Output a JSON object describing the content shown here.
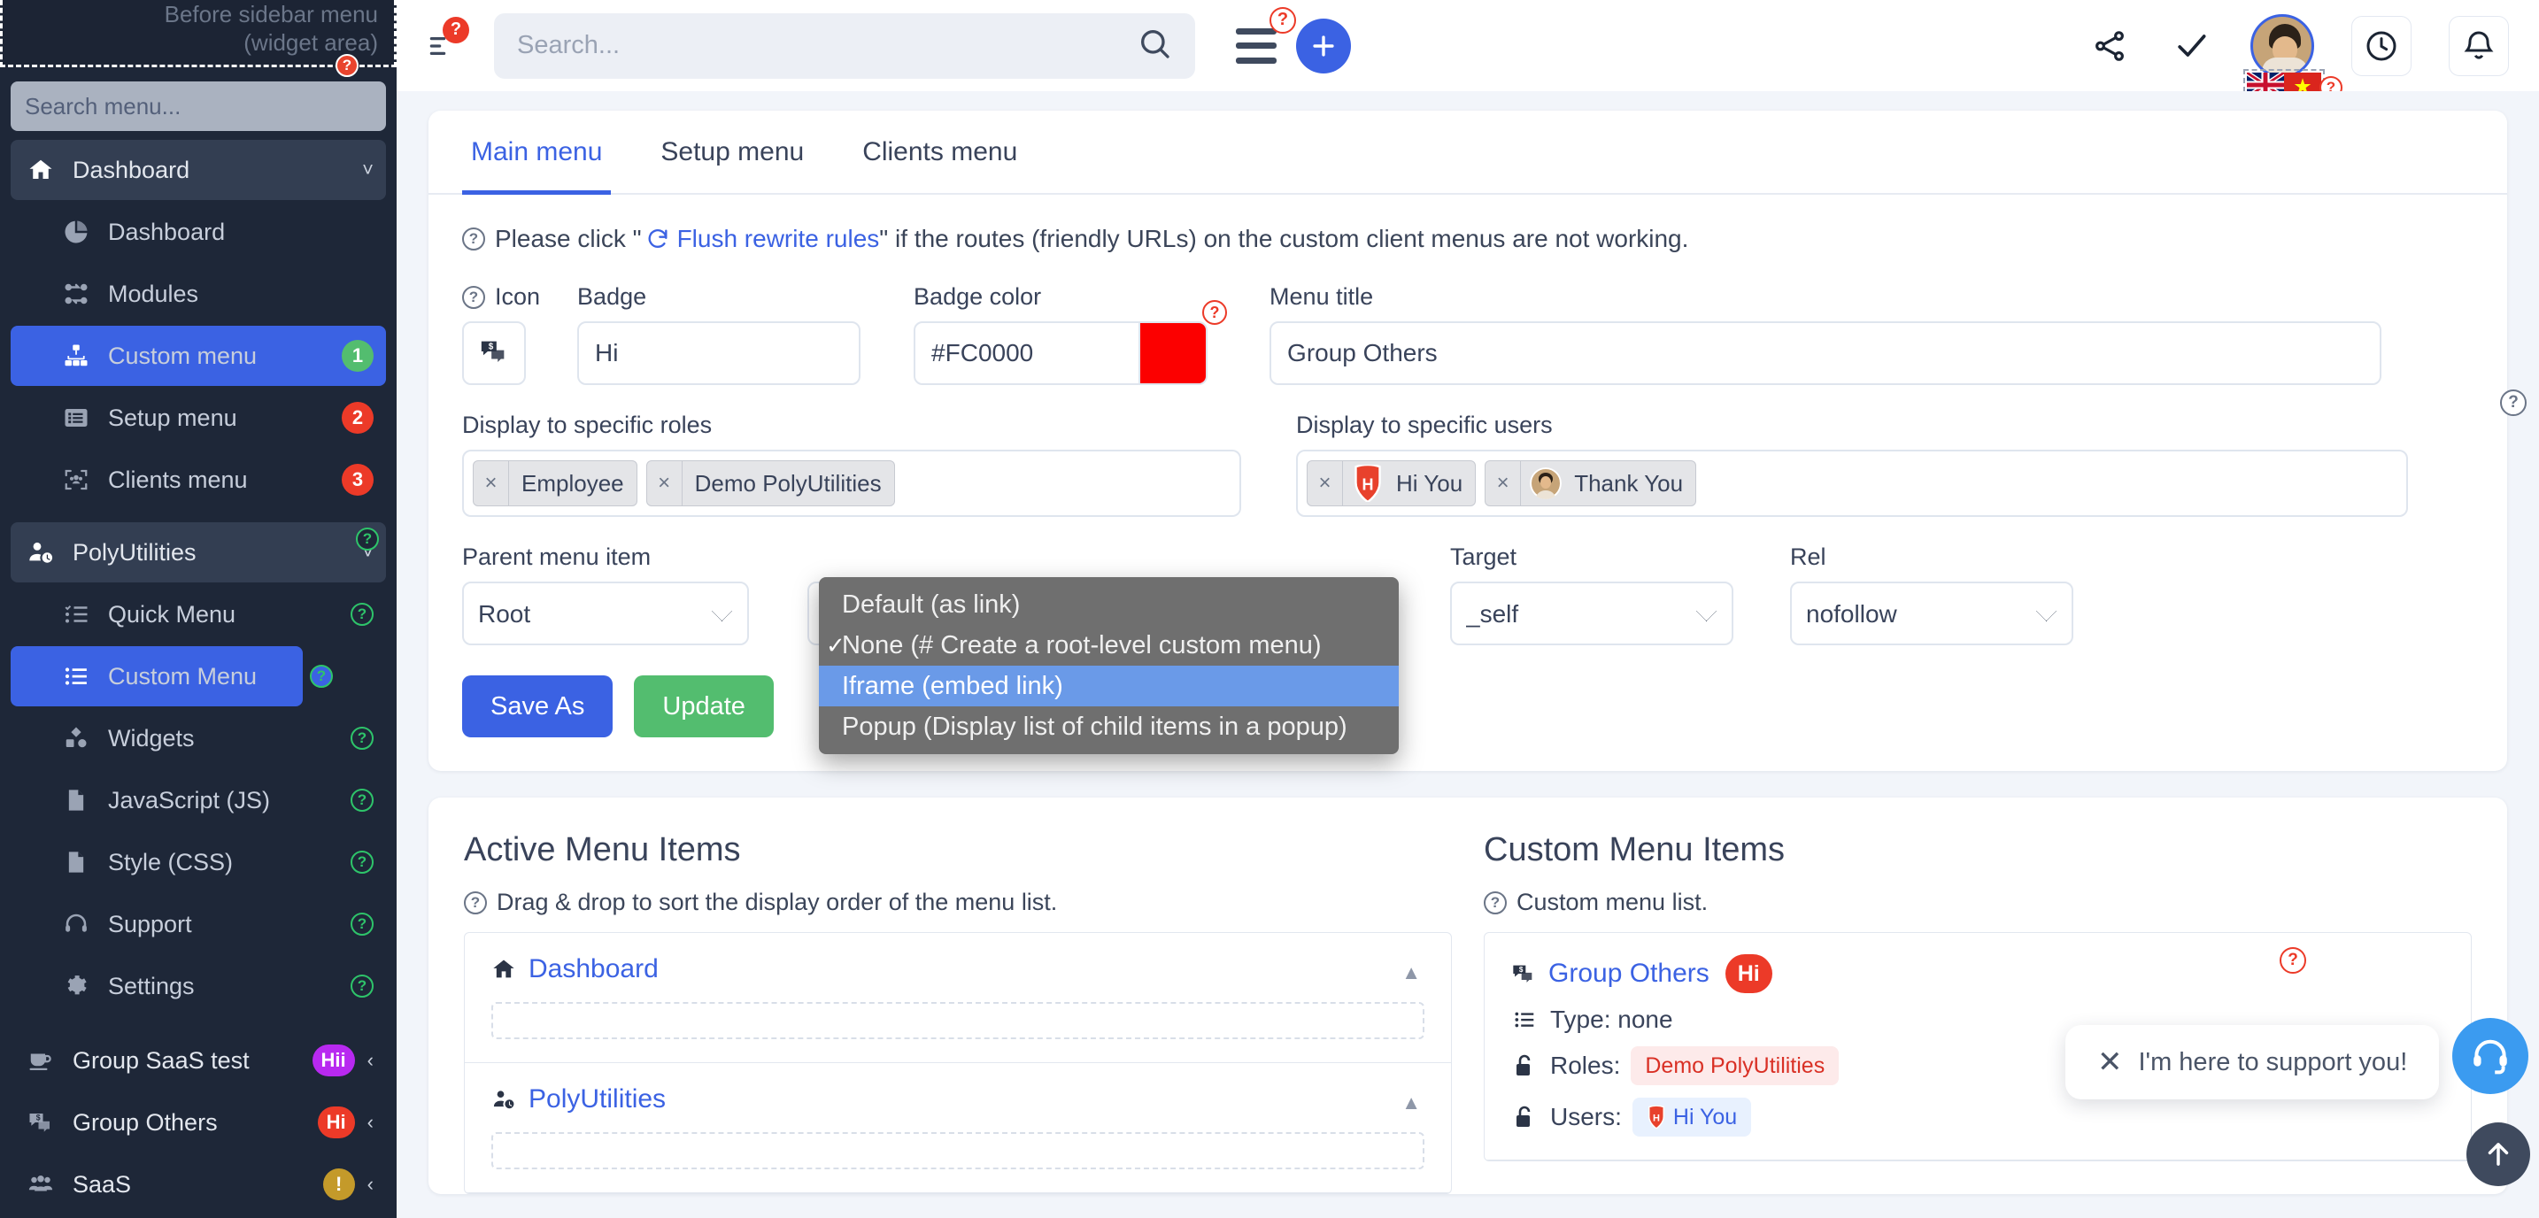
{
  "sidebar": {
    "widget_area_note": "Before sidebar menu (widget area)",
    "search_placeholder": "Search menu...",
    "items": [
      {
        "label": "Dashboard",
        "icon": "home-icon",
        "level": "top",
        "state": "expanded",
        "chevron": "˅"
      },
      {
        "label": "Dashboard",
        "icon": "pie-chart-icon",
        "level": "sub"
      },
      {
        "label": "Modules",
        "icon": "modules-icon",
        "level": "sub"
      },
      {
        "label": "Custom menu",
        "icon": "sitemap-icon",
        "level": "sub",
        "active": true,
        "badge": "1",
        "badge_color": "#53bd6f"
      },
      {
        "label": "Setup menu",
        "icon": "list-box-icon",
        "level": "sub",
        "badge": "2",
        "badge_color": "#ec3a28"
      },
      {
        "label": "Clients menu",
        "icon": "users-frame-icon",
        "level": "sub",
        "badge": "3",
        "badge_color": "#ec3a28"
      },
      {
        "label": "PolyUtilities",
        "icon": "user-clock-icon",
        "level": "top",
        "state": "expanded",
        "chevron": "˅",
        "help": "?"
      },
      {
        "label": "Quick Menu",
        "icon": "checklist-icon",
        "level": "sub",
        "help": "?"
      },
      {
        "label": "Custom Menu",
        "icon": "list-icon",
        "level": "sub",
        "active": true,
        "help": "?"
      },
      {
        "label": "Widgets",
        "icon": "widgets-icon",
        "level": "sub",
        "help": "?"
      },
      {
        "label": "JavaScript (JS)",
        "icon": "file-js-icon",
        "level": "sub",
        "help": "?"
      },
      {
        "label": "Style (CSS)",
        "icon": "file-css-icon",
        "level": "sub",
        "help": "?"
      },
      {
        "label": "Support",
        "icon": "headset-icon",
        "level": "sub",
        "help": "?"
      },
      {
        "label": "Settings",
        "icon": "gear-icon",
        "level": "sub",
        "help": "?"
      },
      {
        "label": "Group SaaS test",
        "icon": "coffee-cup-icon",
        "level": "top",
        "badge": "Hii",
        "badge_color": "#b829f0",
        "chevron": "‹"
      },
      {
        "label": "Group Others",
        "icon": "chat-dollar-icon",
        "level": "top",
        "badge": "Hi",
        "badge_color": "#ec3a28",
        "chevron": "‹"
      },
      {
        "label": "SaaS",
        "icon": "group-users-icon",
        "level": "top",
        "badge": "!",
        "badge_color": "#c49a2a",
        "chevron": "‹"
      }
    ]
  },
  "topbar": {
    "menu_icon": "text-align-icon",
    "menu_badge": "?",
    "search_placeholder": "Search...",
    "search_value": "",
    "search_icon": "search-icon",
    "hamburger_icon": "hamburger-icon",
    "hamburger_badge": "?",
    "add_icon": "plus-icon",
    "share_icon": "share-icon",
    "check_icon": "check-icon",
    "avatar": "user-avatar",
    "flags": [
      "uk-flag",
      "vietnam-flag"
    ],
    "flag_badge": "?",
    "clock_icon": "clock-icon",
    "bell_icon": "bell-icon"
  },
  "main": {
    "tabs": [
      {
        "label": "Main menu",
        "active": true
      },
      {
        "label": "Setup menu",
        "active": false
      },
      {
        "label": "Clients menu",
        "active": false
      }
    ],
    "hint_prefix": "Please click \"",
    "hint_link": "Flush rewrite rules",
    "hint_suffix": "\" if the routes (friendly URLs) on the custom client menus are not working.",
    "fields": {
      "icon_label": "Icon",
      "icon_value": "chat-dollar-icon",
      "badge_label": "Badge",
      "badge_value": "Hi",
      "badge_color_label": "Badge color",
      "badge_color_value": "#FC0000",
      "badge_color_swatch": "#FC0000",
      "badge_color_help": "?",
      "menu_title_label": "Menu title",
      "menu_title_value": "Group Others",
      "roles_label": "Display to specific roles",
      "roles": [
        "Employee",
        "Demo PolyUtilities"
      ],
      "users_label": "Display to specific users",
      "users": [
        "Hi You",
        "Thank You"
      ],
      "parent_label": "Parent menu item",
      "parent_value": "Root",
      "target_label": "Target",
      "target_value": "_self",
      "rel_label": "Rel",
      "rel_value": "nofollow",
      "side_help": "?"
    },
    "dropdown": {
      "options": [
        {
          "label": "Default (as link)",
          "checked": false,
          "highlighted": false
        },
        {
          "label": "None (# Create a root-level custom menu)",
          "checked": true,
          "highlighted": false
        },
        {
          "label": "Iframe (embed link)",
          "checked": false,
          "highlighted": true
        },
        {
          "label": "Popup (Display list of child items in a popup)",
          "checked": false,
          "highlighted": false
        }
      ]
    },
    "buttons": {
      "save_as": "Save As",
      "update": "Update"
    },
    "active_menu": {
      "title": "Active Menu Items",
      "subtitle": "Drag & drop to sort the display order of the menu list.",
      "items": [
        {
          "label": "Dashboard",
          "icon": "home-icon"
        },
        {
          "label": "PolyUtilities",
          "icon": "user-clock-icon"
        }
      ]
    },
    "custom_menu": {
      "title": "Custom Menu Items",
      "subtitle": "Custom menu list.",
      "help": "?",
      "items": [
        {
          "label": "Group Others",
          "icon": "chat-dollar-icon",
          "badge": "Hi",
          "badge_color": "#ec3a28",
          "type_label": "Type: none",
          "roles_label": "Roles:",
          "roles": [
            "Demo PolyUtilities"
          ],
          "users_label": "Users:",
          "users": [
            "Hi You"
          ]
        }
      ]
    }
  },
  "support": {
    "bubble_text": "I'm here to support you!",
    "close_icon": "close-icon",
    "fab_icon": "headset-icon",
    "scroll_top_icon": "arrow-up-icon"
  }
}
